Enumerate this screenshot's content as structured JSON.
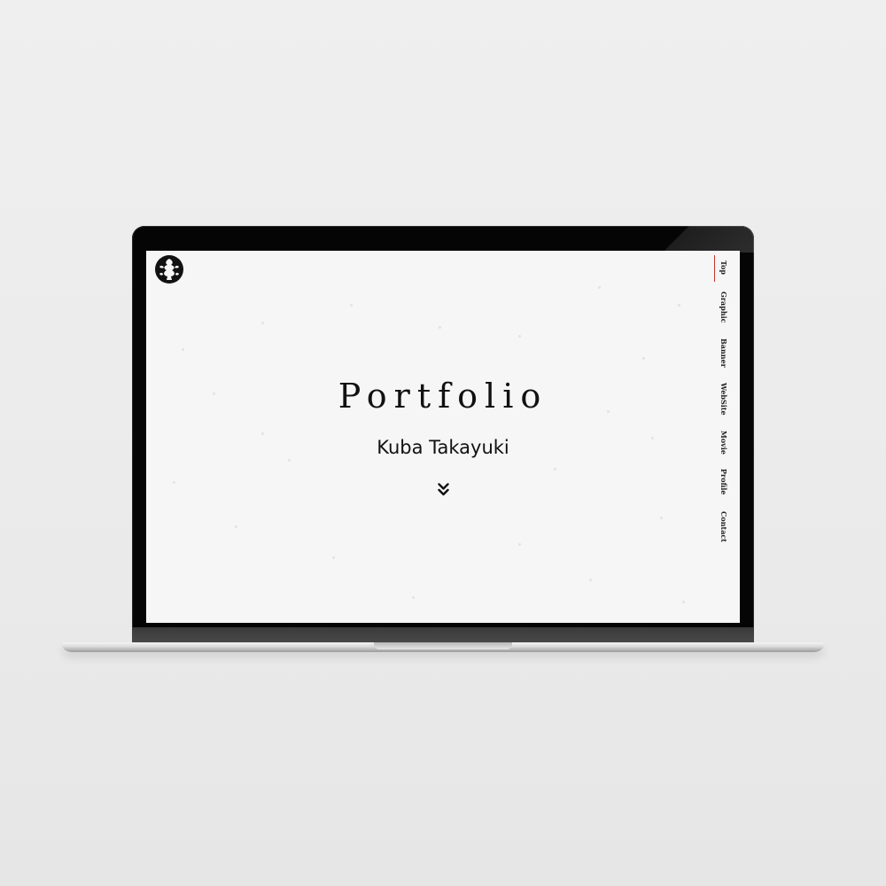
{
  "site": {
    "title": "Portfolio",
    "author": "Kuba Takayuki",
    "logo_icon": "emblem-logo-icon",
    "scroll_icon": "double-chevron-down-icon"
  },
  "nav": {
    "items": [
      {
        "label": "Top",
        "active": true
      },
      {
        "label": "Graphic",
        "active": false
      },
      {
        "label": "Banner",
        "active": false
      },
      {
        "label": "WebSite",
        "active": false
      },
      {
        "label": "Movie",
        "active": false
      },
      {
        "label": "Profile",
        "active": false
      },
      {
        "label": "Contact",
        "active": false
      }
    ]
  },
  "colors": {
    "background": "#ececec",
    "screen": "#f6f6f6",
    "bezel": "#050505",
    "text": "#111111",
    "active_indicator": "#c0392b"
  }
}
